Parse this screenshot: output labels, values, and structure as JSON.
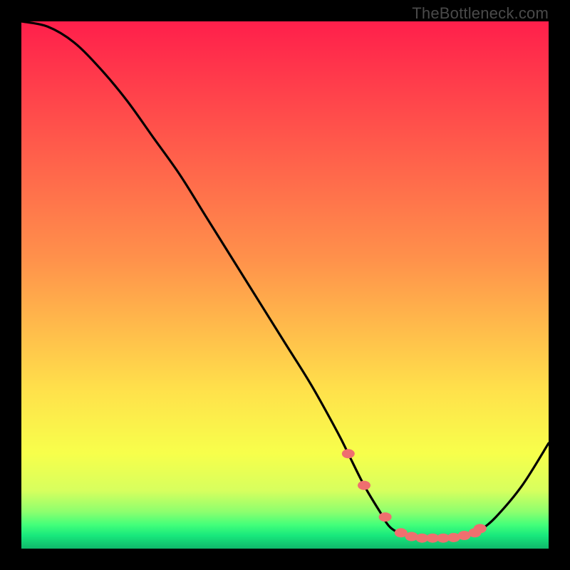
{
  "watermark": "TheBottleneck.com",
  "chart_data": {
    "type": "line",
    "title": "",
    "xlabel": "",
    "ylabel": "",
    "xlim": [
      0,
      100
    ],
    "ylim": [
      0,
      100
    ],
    "gradient_stops": [
      {
        "pos": 0,
        "color": "#ff1f4b"
      },
      {
        "pos": 0.45,
        "color": "#ff914b"
      },
      {
        "pos": 0.7,
        "color": "#ffe14b"
      },
      {
        "pos": 0.82,
        "color": "#f7ff4b"
      },
      {
        "pos": 0.89,
        "color": "#d7ff5e"
      },
      {
        "pos": 0.93,
        "color": "#8dff6e"
      },
      {
        "pos": 0.955,
        "color": "#42ff7a"
      },
      {
        "pos": 0.975,
        "color": "#18e87c"
      },
      {
        "pos": 1.0,
        "color": "#0fb86b"
      }
    ],
    "series": [
      {
        "name": "bottleneck-curve",
        "x": [
          0,
          5,
          10,
          15,
          20,
          25,
          30,
          35,
          40,
          45,
          50,
          55,
          60,
          62,
          65,
          68,
          70,
          73,
          77,
          81,
          85,
          87,
          90,
          95,
          100
        ],
        "y": [
          100,
          99,
          96,
          91,
          85,
          78,
          71,
          63,
          55,
          47,
          39,
          31,
          22,
          18,
          12,
          7,
          4,
          2.5,
          2,
          2,
          2.5,
          3.5,
          6,
          12,
          20
        ]
      }
    ],
    "markers": {
      "name": "highlight-dots",
      "color": "#ef6f6f",
      "x": [
        62,
        65,
        69,
        72,
        74,
        76,
        78,
        80,
        82,
        84,
        86,
        87
      ],
      "y": [
        18,
        12,
        6,
        3,
        2.3,
        2,
        2,
        2,
        2.1,
        2.5,
        3,
        3.8
      ]
    }
  }
}
